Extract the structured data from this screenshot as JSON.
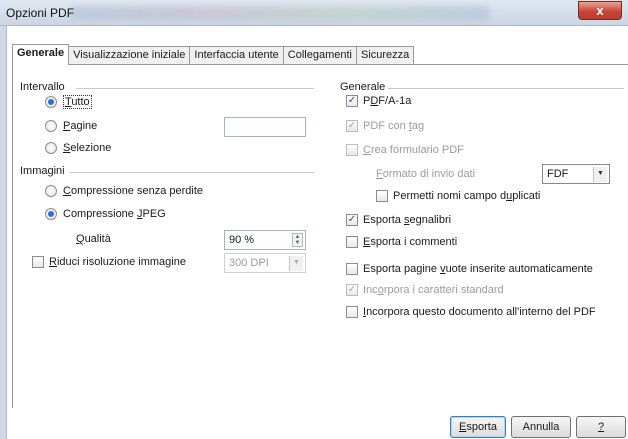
{
  "window": {
    "title": "Opzioni PDF",
    "close_label": "x"
  },
  "tabs": [
    {
      "label": "Generale",
      "active": true
    },
    {
      "label": "Visualizzazione iniziale",
      "active": false
    },
    {
      "label": "Interfaccia utente",
      "active": false
    },
    {
      "label": "Collegamenti",
      "active": false
    },
    {
      "label": "Sicurezza",
      "active": false
    }
  ],
  "intervallo": {
    "title": "Intervallo",
    "tutto": {
      "accel": "T",
      "rest": "utto",
      "selected": true
    },
    "pagine": {
      "accel": "P",
      "rest": "agine",
      "value": ""
    },
    "selezione": {
      "accel": "S",
      "rest": "elezione"
    }
  },
  "immagini": {
    "title": "Immagini",
    "lossless": {
      "accel": "C",
      "rest": "ompressione senza perdite"
    },
    "jpeg": {
      "pre": "Compressione ",
      "accel": "J",
      "rest": "PEG",
      "selected": true
    },
    "quality": {
      "accel": "Q",
      "rest": "ualità",
      "value": "90 %"
    },
    "reduce": {
      "accel": "R",
      "rest": "iduci risoluzione immagine",
      "value": "300 DPI",
      "checked": false
    }
  },
  "generale": {
    "title": "Generale",
    "pdfa": {
      "pre": "P",
      "accel": "D",
      "rest": "F/A-1a",
      "checked": true
    },
    "tagged": {
      "pre": "PDF con ",
      "accel": "t",
      "rest": "ag",
      "checked": true
    },
    "create_form": {
      "accel": "C",
      "rest": "rea formulario PDF",
      "checked": false
    },
    "submit_format": {
      "accel": "F",
      "rest": "ormato di invio dati",
      "value": "FDF"
    },
    "duplicate_names": {
      "pre": "Permetti nomi campo d",
      "accel": "u",
      "rest": "plicati",
      "checked": false
    },
    "bookmarks": {
      "pre": "Esporta ",
      "accel": "s",
      "rest": "egnalibri",
      "checked": true
    },
    "comments": {
      "accel": "E",
      "rest": "sporta i commenti",
      "checked": false
    },
    "empty_pages": {
      "pre": "Esporta pagine ",
      "accel": "v",
      "rest": "uote inserite automaticamente",
      "checked": false
    },
    "std_fonts": {
      "pre": "Inc",
      "accel": "o",
      "rest": "rpora i caratteri standard",
      "checked": true
    },
    "embed_doc": {
      "accel": "I",
      "rest": "ncorpora questo documento all'interno del PDF",
      "checked": false
    }
  },
  "buttons": {
    "export": {
      "accel": "E",
      "rest": "sporta"
    },
    "cancel": "Annulla",
    "help": "?"
  },
  "colors": {
    "accent": "#2d6fd1",
    "title_bar": "#cbd6e4",
    "disabled_text": "#9b9b9b"
  }
}
